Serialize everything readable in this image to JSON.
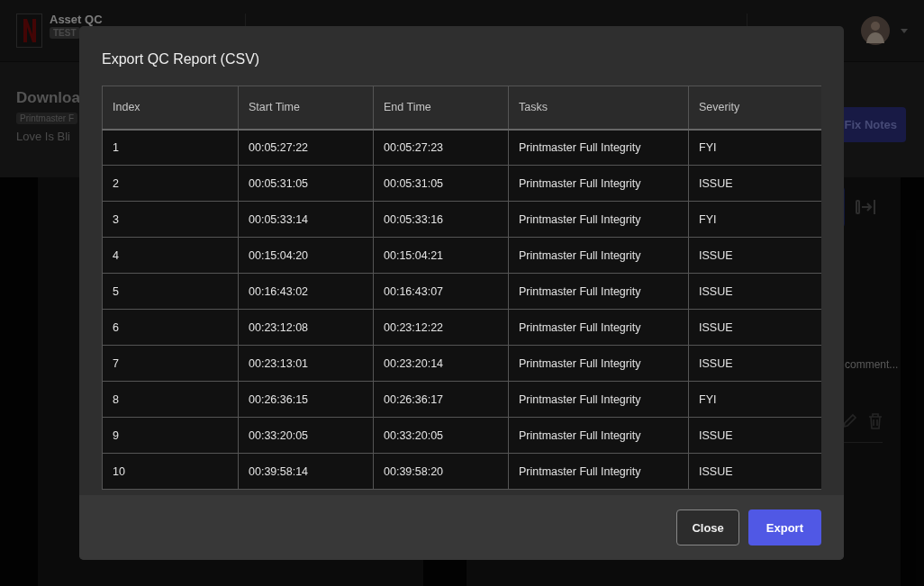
{
  "header": {
    "app_title": "Asset QC",
    "env_badge": "TEST"
  },
  "page": {
    "title": "Downloa",
    "tag": "Printmaster F",
    "subtitle": "Love Is Bli",
    "fix_button": "Fix Notes",
    "comment_placeholder": "comment..."
  },
  "modal": {
    "title": "Export QC Report (CSV)",
    "columns": [
      "Index",
      "Start Time",
      "End Time",
      "Tasks",
      "Severity"
    ],
    "rows": [
      [
        "1",
        "00:05:27:22",
        "00:05:27:23",
        "Printmaster Full Integrity",
        "FYI"
      ],
      [
        "2",
        "00:05:31:05",
        "00:05:31:05",
        "Printmaster Full Integrity",
        "ISSUE"
      ],
      [
        "3",
        "00:05:33:14",
        "00:05:33:16",
        "Printmaster Full Integrity",
        "FYI"
      ],
      [
        "4",
        "00:15:04:20",
        "00:15:04:21",
        "Printmaster Full Integrity",
        "ISSUE"
      ],
      [
        "5",
        "00:16:43:02",
        "00:16:43:07",
        "Printmaster Full Integrity",
        "ISSUE"
      ],
      [
        "6",
        "00:23:12:08",
        "00:23:12:22",
        "Printmaster Full Integrity",
        "ISSUE"
      ],
      [
        "7",
        "00:23:13:01",
        "00:23:20:14",
        "Printmaster Full Integrity",
        "ISSUE"
      ],
      [
        "8",
        "00:26:36:15",
        "00:26:36:17",
        "Printmaster Full Integrity",
        "FYI"
      ],
      [
        "9",
        "00:33:20:05",
        "00:33:20:05",
        "Printmaster Full Integrity",
        "ISSUE"
      ],
      [
        "10",
        "00:39:58:14",
        "00:39:58:20",
        "Printmaster Full Integrity",
        "ISSUE"
      ]
    ],
    "buttons": [
      {
        "label": "Close",
        "kind": "secondary"
      },
      {
        "label": "Export",
        "kind": "primary"
      }
    ]
  }
}
